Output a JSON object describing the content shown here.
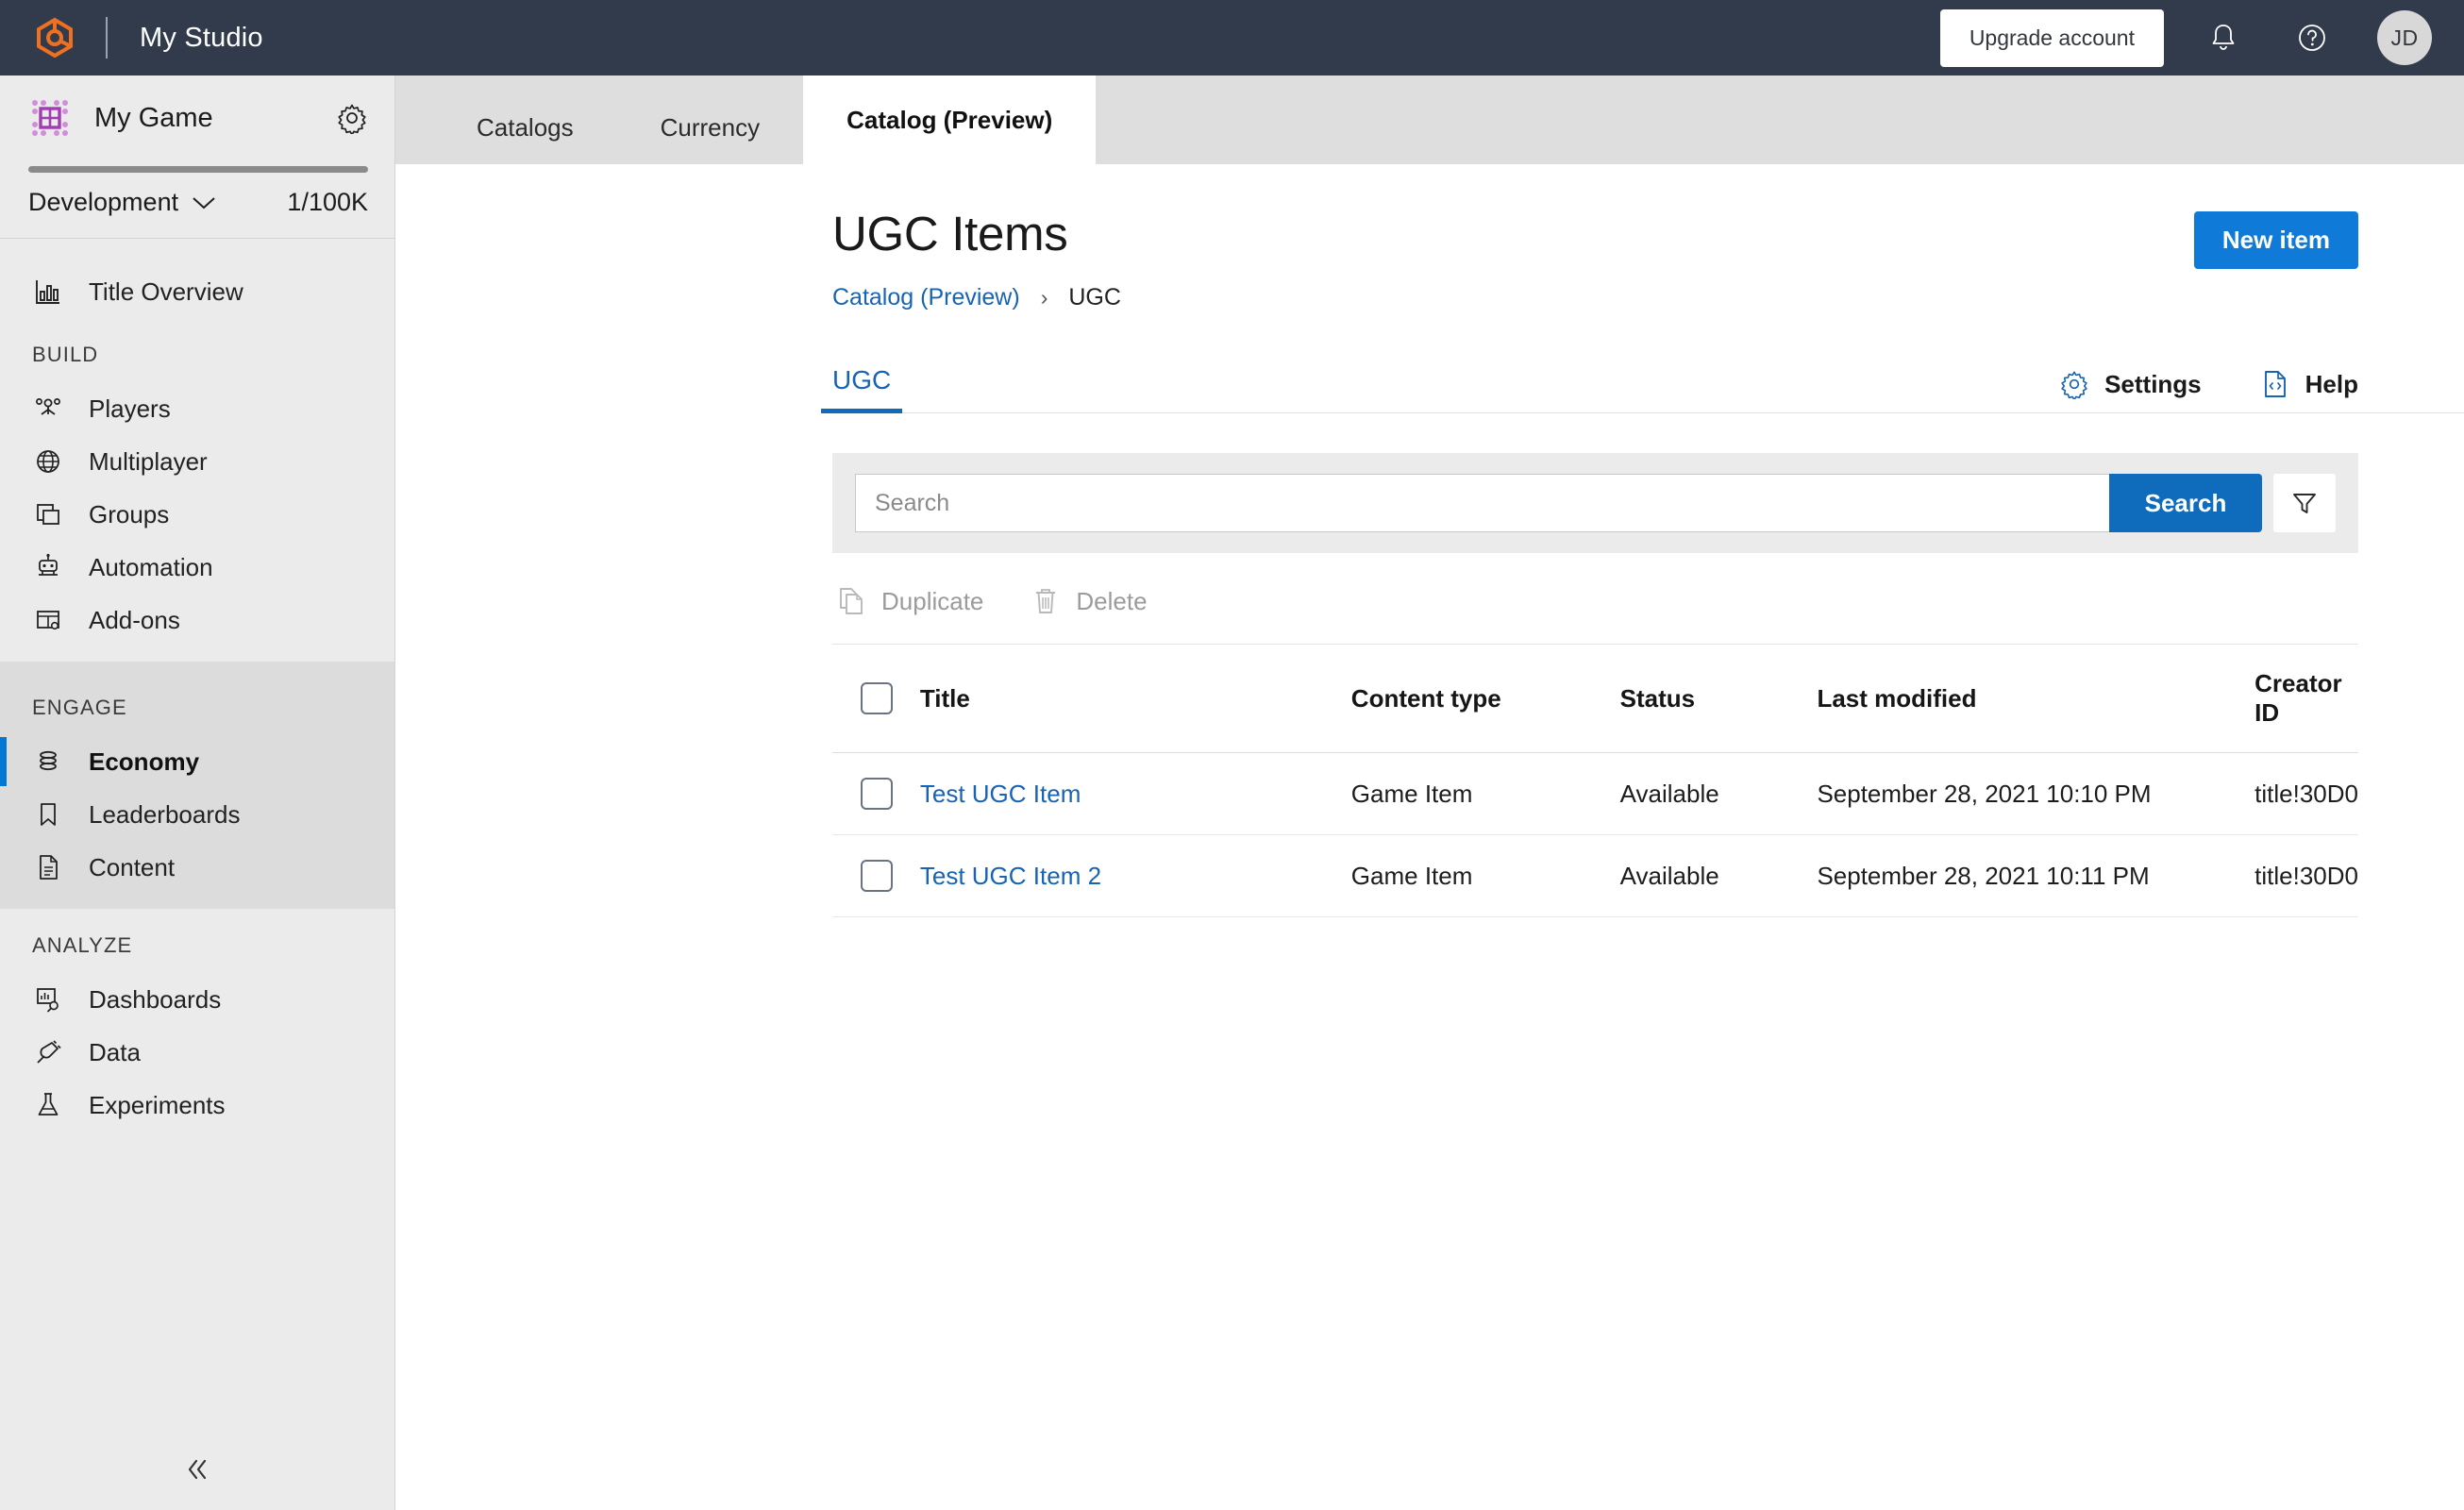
{
  "topbar": {
    "brand_title": "My Studio",
    "upgrade_label": "Upgrade account",
    "notifications_icon": "bell-icon",
    "help_icon": "question-circle-icon",
    "avatar_initials": "JD",
    "bg_color": "#323b4c",
    "logo_color": "#f07021"
  },
  "sidebar": {
    "game_name": "My Game",
    "gear_icon": "gear-icon",
    "environment": "Development",
    "quota": "1/100K",
    "overview": {
      "label": "Title Overview",
      "icon": "bar-chart-icon"
    },
    "groups": [
      {
        "label": "BUILD",
        "items": [
          {
            "label": "Players",
            "icon": "people-icon",
            "selected": false
          },
          {
            "label": "Multiplayer",
            "icon": "globe-icon",
            "selected": false
          },
          {
            "label": "Groups",
            "icon": "stacked-squares-icon",
            "selected": false
          },
          {
            "label": "Automation",
            "icon": "robot-icon",
            "selected": false
          },
          {
            "label": "Add-ons",
            "icon": "addon-table-icon",
            "selected": false
          }
        ]
      },
      {
        "label": "ENGAGE",
        "items": [
          {
            "label": "Economy",
            "icon": "coins-stack-icon",
            "selected": true
          },
          {
            "label": "Leaderboards",
            "icon": "bookmark-icon",
            "selected": false
          },
          {
            "label": "Content",
            "icon": "document-lines-icon",
            "selected": false
          }
        ]
      },
      {
        "label": "ANALYZE",
        "items": [
          {
            "label": "Dashboards",
            "icon": "dashboard-search-icon",
            "selected": false
          },
          {
            "label": "Data",
            "icon": "plug-icon",
            "selected": false
          },
          {
            "label": "Experiments",
            "icon": "flask-icon",
            "selected": false
          }
        ]
      }
    ],
    "collapse_icon": "double-chevron-left-icon",
    "accent_color": "#0078d4"
  },
  "tabs": [
    {
      "label": "Catalogs",
      "active": false
    },
    {
      "label": "Currency",
      "active": false
    },
    {
      "label": "Catalog (Preview)",
      "active": true
    }
  ],
  "page": {
    "title": "UGC Items",
    "new_item_label": "New item",
    "breadcrumb": {
      "parent": "Catalog (Preview)",
      "separator": "›",
      "current": "UGC"
    },
    "subtab": "UGC",
    "settings_label": "Settings",
    "settings_icon": "gear-icon",
    "help_label": "Help",
    "help_icon": "code-document-icon",
    "primary_color": "#0f6cbd",
    "link_color": "#1763b5"
  },
  "search": {
    "placeholder": "Search",
    "value": "",
    "button_label": "Search",
    "filter_icon": "funnel-icon"
  },
  "table_actions": [
    {
      "label": "Duplicate",
      "icon": "copy-icon",
      "disabled": true
    },
    {
      "label": "Delete",
      "icon": "trash-icon",
      "disabled": true
    }
  ],
  "table": {
    "columns": [
      "Title",
      "Content type",
      "Status",
      "Last modified",
      "Creator ID"
    ],
    "rows": [
      {
        "title": "Test UGC Item",
        "content_type": "Game Item",
        "status": "Available",
        "last_modified": "September 28, 2021 10:10 PM",
        "creator_id": "title!30D0",
        "checked": false
      },
      {
        "title": "Test UGC Item 2",
        "content_type": "Game Item",
        "status": "Available",
        "last_modified": "September 28, 2021 10:11 PM",
        "creator_id": "title!30D0",
        "checked": false
      }
    ]
  }
}
